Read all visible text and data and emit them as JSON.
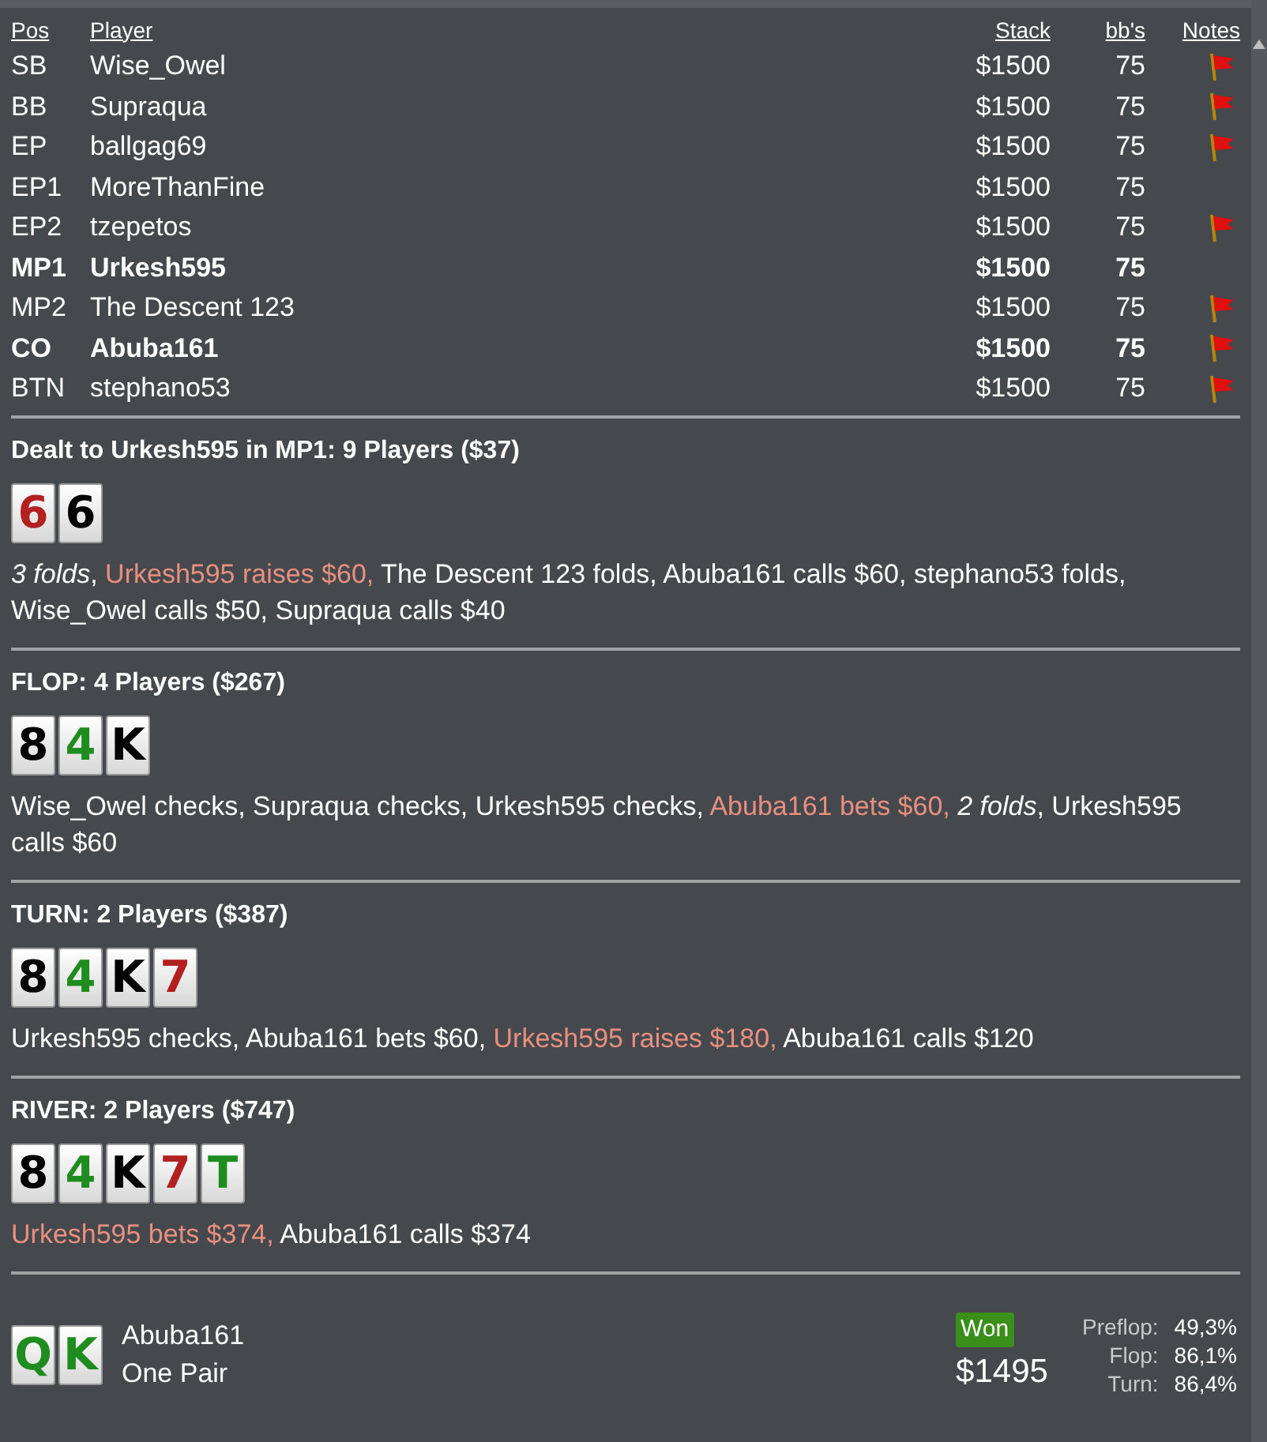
{
  "columns": {
    "pos": "Pos",
    "player": "Player",
    "stack": "Stack",
    "bbs": "bb's",
    "notes": "Notes"
  },
  "players": [
    {
      "pos": "SB",
      "name": "Wise_Owel",
      "stack": "$1500",
      "bbs": "75",
      "highlighted": false,
      "note": true
    },
    {
      "pos": "BB",
      "name": "Supraqua",
      "stack": "$1500",
      "bbs": "75",
      "highlighted": false,
      "note": true
    },
    {
      "pos": "EP",
      "name": "ballgag69",
      "stack": "$1500",
      "bbs": "75",
      "highlighted": false,
      "note": true
    },
    {
      "pos": "EP1",
      "name": "MoreThanFine",
      "stack": "$1500",
      "bbs": "75",
      "highlighted": false,
      "note": false
    },
    {
      "pos": "EP2",
      "name": "tzepetos",
      "stack": "$1500",
      "bbs": "75",
      "highlighted": false,
      "note": true
    },
    {
      "pos": "MP1",
      "name": "Urkesh595",
      "stack": "$1500",
      "bbs": "75",
      "highlighted": true,
      "note": false
    },
    {
      "pos": "MP2",
      "name": "The Descent 123",
      "stack": "$1500",
      "bbs": "75",
      "highlighted": false,
      "note": true
    },
    {
      "pos": "CO",
      "name": "Abuba161",
      "stack": "$1500",
      "bbs": "75",
      "highlighted": true,
      "note": true
    },
    {
      "pos": "BTN",
      "name": "stephano53",
      "stack": "$1500",
      "bbs": "75",
      "highlighted": false,
      "note": true
    }
  ],
  "streets": [
    {
      "title": "Dealt to Urkesh595 in MP1: 9 Players ($37)",
      "cards": [
        {
          "rank": "6",
          "color": "#b22020"
        },
        {
          "rank": "6",
          "color": "#000000"
        }
      ],
      "actions": [
        {
          "kind": "italic",
          "text": "3 folds"
        },
        {
          "kind": "plain",
          "text": ", "
        },
        {
          "kind": "hero",
          "text": "Urkesh595 raises $60,"
        },
        {
          "kind": "plain",
          "text": " The Descent 123 folds, Abuba161 calls $60, stephano53 folds, Wise_Owel calls $50, Supraqua calls $40"
        }
      ]
    },
    {
      "title": "FLOP: 4 Players ($267)",
      "cards": [
        {
          "rank": "8",
          "color": "#000000"
        },
        {
          "rank": "4",
          "color": "#1e8c1e"
        },
        {
          "rank": "K",
          "color": "#000000"
        }
      ],
      "actions": [
        {
          "kind": "plain",
          "text": "Wise_Owel checks, Supraqua checks, Urkesh595 checks, "
        },
        {
          "kind": "hero",
          "text": "Abuba161 bets $60, "
        },
        {
          "kind": "italic",
          "text": "2 folds"
        },
        {
          "kind": "plain",
          "text": ", Urkesh595 calls $60"
        }
      ]
    },
    {
      "title": "TURN: 2 Players ($387)",
      "cards": [
        {
          "rank": "8",
          "color": "#000000"
        },
        {
          "rank": "4",
          "color": "#1e8c1e"
        },
        {
          "rank": "K",
          "color": "#000000"
        },
        {
          "rank": "7",
          "color": "#b22020"
        }
      ],
      "actions": [
        {
          "kind": "plain",
          "text": "Urkesh595 checks, Abuba161 bets $60, "
        },
        {
          "kind": "hero",
          "text": "Urkesh595 raises $180,"
        },
        {
          "kind": "plain",
          "text": " Abuba161 calls $120"
        }
      ]
    },
    {
      "title": "RIVER: 2 Players ($747)",
      "cards": [
        {
          "rank": "8",
          "color": "#000000"
        },
        {
          "rank": "4",
          "color": "#1e8c1e"
        },
        {
          "rank": "K",
          "color": "#000000"
        },
        {
          "rank": "7",
          "color": "#b22020"
        },
        {
          "rank": "T",
          "color": "#1e8c1e"
        }
      ],
      "actions": [
        {
          "kind": "hero",
          "text": "Urkesh595 bets $374,"
        },
        {
          "kind": "plain",
          "text": " Abuba161 calls $374"
        }
      ]
    }
  ],
  "result": {
    "cards": [
      {
        "rank": "Q",
        "color": "#1e8c1e"
      },
      {
        "rank": "K",
        "color": "#1e8c1e"
      }
    ],
    "player": "Abuba161",
    "hand": "One Pair",
    "badge": "Won",
    "amount": "$1495",
    "equity": [
      {
        "label": "Preflop:",
        "value": "49,3%"
      },
      {
        "label": "Flop:",
        "value": "86,1%"
      },
      {
        "label": "Turn:",
        "value": "86,4%"
      }
    ]
  }
}
